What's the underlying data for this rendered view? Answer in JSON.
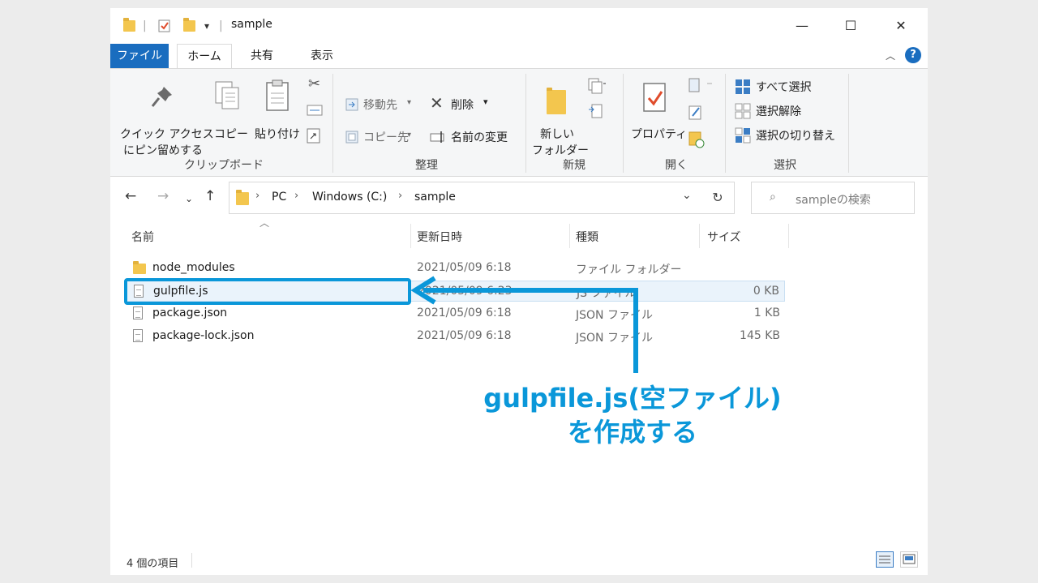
{
  "window": {
    "title": "sample",
    "controls": {
      "minimize": "—",
      "maximize": "☐",
      "close": "✕"
    }
  },
  "ribbon_tabs": {
    "file": "ファイル",
    "home": "ホーム",
    "share": "共有",
    "view": "表示"
  },
  "ribbon": {
    "clipboard": {
      "label": "クリップボード",
      "quick_access_1": "クイック アクセス",
      "quick_access_2": "にピン留めする",
      "copy": "コピー",
      "paste": "貼り付け"
    },
    "organize": {
      "label": "整理",
      "move_to": "移動先",
      "copy_to": "コピー先",
      "delete": "削除",
      "rename": "名前の変更"
    },
    "new": {
      "label": "新規",
      "new_folder_1": "新しい",
      "new_folder_2": "フォルダー"
    },
    "open": {
      "label": "開く",
      "properties": "プロパティ"
    },
    "select": {
      "label": "選択",
      "select_all": "すべて選択",
      "select_none": "選択解除",
      "invert": "選択の切り替え"
    }
  },
  "address": {
    "crumbs": [
      "PC",
      "Windows (C:)",
      "sample"
    ],
    "search_placeholder": "sampleの検索"
  },
  "columns": {
    "name": "名前",
    "date": "更新日時",
    "type": "種類",
    "size": "サイズ"
  },
  "files": [
    {
      "name": "node_modules",
      "date": "2021/05/09 6:18",
      "type": "ファイル フォルダー",
      "size": "",
      "icon": "folder-icon"
    },
    {
      "name": "gulpfile.js",
      "date": "2021/05/09 6:23",
      "type": "JS ファイル",
      "size": "0 KB",
      "icon": "file-icon"
    },
    {
      "name": "package.json",
      "date": "2021/05/09 6:18",
      "type": "JSON ファイル",
      "size": "1 KB",
      "icon": "file-icon"
    },
    {
      "name": "package-lock.json",
      "date": "2021/05/09 6:18",
      "type": "JSON ファイル",
      "size": "145 KB",
      "icon": "file-icon"
    }
  ],
  "status": {
    "item_count": "4 個の項目"
  },
  "annotation": {
    "line1": "gulpfile.js(空ファイル)",
    "line2": "を作成する",
    "color": "#0a97d9"
  }
}
